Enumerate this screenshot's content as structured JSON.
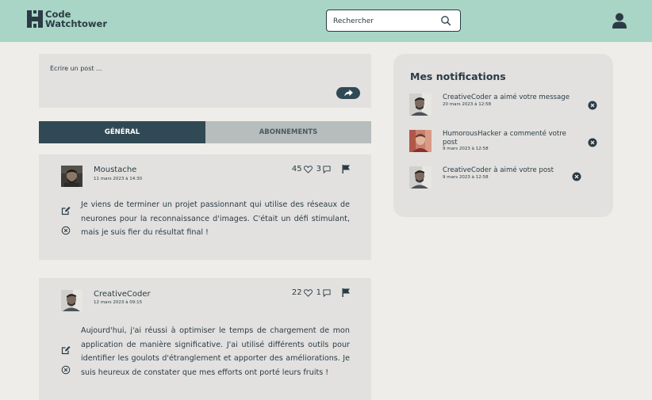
{
  "header": {
    "logo_line1": "Code",
    "logo_line2": "Watchtower",
    "search_placeholder": "Rechercher",
    "bg_color": "#a8d5c5"
  },
  "composer": {
    "placeholder": "Écrire un post ...",
    "share_icon": "share-arrow-icon"
  },
  "tabs": [
    {
      "label": "GÉNÉRAL",
      "active": true
    },
    {
      "label": "ABONNEMENTS",
      "active": false
    }
  ],
  "posts": [
    {
      "author": "Moustache",
      "date": "11 mars 2023 à 14:30",
      "likes": "45",
      "comments": "3",
      "text": "Je viens de terminer un projet passionnant qui utilise des réseaux de neurones pour la reconnaissance d'images. C'était un défi stimulant, mais je suis fier du résultat final !"
    },
    {
      "author": "CreativeCoder",
      "date": "12 mars 2023 à 09:15",
      "likes": "22",
      "comments": "1",
      "text": "Aujourd'hui, j'ai réussi à optimiser le temps de chargement de mon application de manière significative. J'ai utilisé différents outils pour identifier les goulots d'étranglement et apporter des améliorations. Je suis heureux de constater que mes efforts ont porté leurs fruits !"
    }
  ],
  "notifications": {
    "title": "Mes notifications",
    "items": [
      {
        "message": "CreativeCoder a aimé votre message",
        "date": "20 mars 2023 à 12:58"
      },
      {
        "message": "HumorousHacker a commenté votre post",
        "date": "9 mars 2023 à 12:58"
      },
      {
        "message": "CreativeCoder à aimé votre post",
        "date": "9 mars 2023 à 12:58"
      }
    ]
  },
  "colors": {
    "accent": "#304955",
    "panel": "#e2e1df",
    "background": "#eeede9",
    "tab_inactive": "#b7bcbc"
  }
}
